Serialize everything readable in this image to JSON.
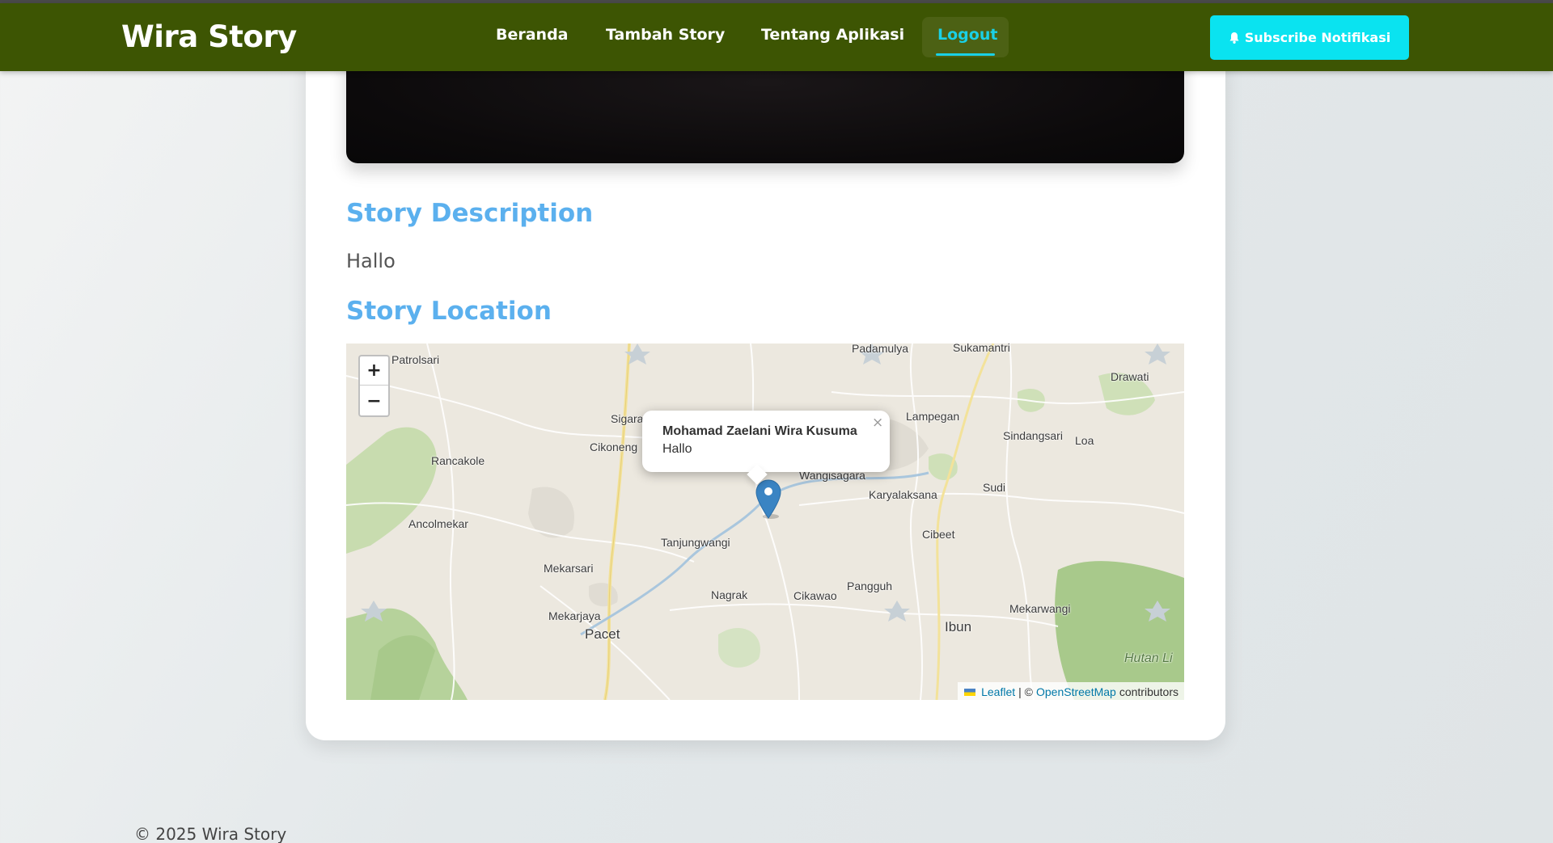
{
  "navbar": {
    "brand": "Wira Story",
    "links": [
      "Beranda",
      "Tambah Story",
      "Tentang Aplikasi"
    ],
    "active_link": "Logout",
    "subscribe_label": "Subscribe Notifikasi",
    "colors": {
      "bar": "#3d5503",
      "accent": "#1ad0e6",
      "subscribe": "#0ae3f0"
    }
  },
  "story": {
    "description_title": "Story Description",
    "description": "Hallo",
    "location_title": "Story Location",
    "title_color": "#5bb0ee"
  },
  "map": {
    "zoom_in": "+",
    "zoom_out": "−",
    "popup": {
      "name": "Mohamad Zaelani Wira Kusuma",
      "text": "Hallo",
      "close": "×"
    },
    "places": [
      "Patrolsari",
      "Padamulya",
      "Sukamantri",
      "Drawati",
      "Sigaraja",
      "Lampegan",
      "Sindangsari",
      "Loa",
      "Cikoneng",
      "Rancakole",
      "Wangisagara",
      "Karyalaksana",
      "Sudi",
      "Ancolmekar",
      "Cibeet",
      "Tanjungwangi",
      "Mekarsari",
      "Pangguh",
      "Nagrak",
      "Cikawao",
      "Mekarwangi",
      "Mekarjaya",
      "Pacet",
      "Ibun",
      "Hutan Li"
    ],
    "attribution": {
      "leaflet": "Leaflet",
      "sep": "| ©",
      "osm": "OpenStreetMap",
      "suffix": "contributors"
    }
  },
  "footer": {
    "text": "© 2025 Wira Story"
  }
}
